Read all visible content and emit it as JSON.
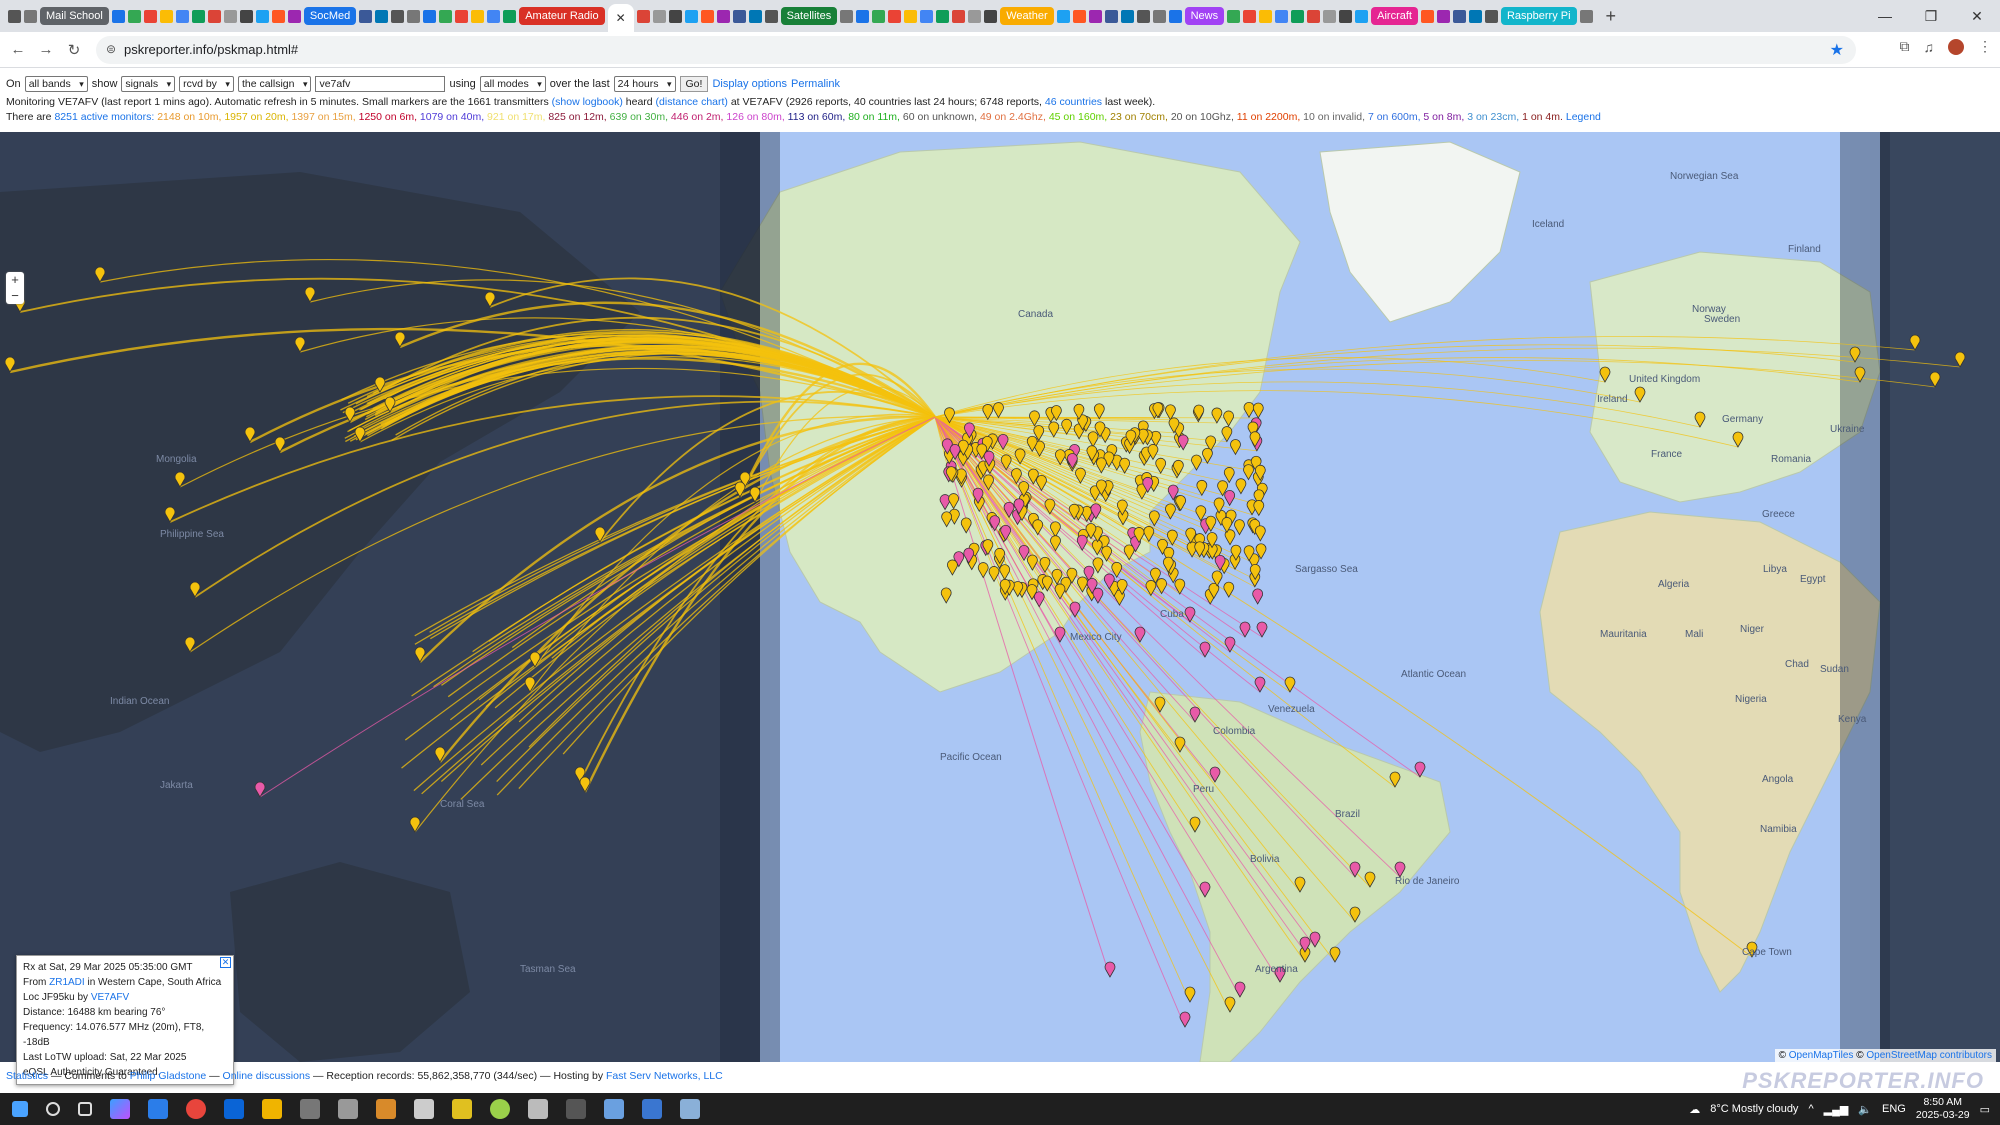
{
  "browser": {
    "tab_groups": [
      "Mail School",
      "SocMed",
      "Amateur Radio",
      "Satellites",
      "Weather",
      "News",
      "Aircraft",
      "Raspberry Pi"
    ],
    "tab_group_colors": [
      "#5f6368",
      "#1a73e8",
      "#d93025",
      "#188038",
      "#f9ab00",
      "#a142f4",
      "#e52592",
      "#12b5cb"
    ],
    "new_tab": "+",
    "url": "pskreporter.info/pskmap.html#",
    "window_controls": [
      "—",
      "❐",
      "✕"
    ]
  },
  "controls": {
    "on_label": "On",
    "band": "all bands",
    "show_label": "show",
    "show_value": "signals",
    "rcvd": "rcvd by",
    "callsign_scope": "the callsign",
    "callsign": "ve7afv",
    "using_label": "using",
    "mode": "all modes",
    "over_label": "over the last",
    "period": "24 hours",
    "go": "Go!",
    "display_options": "Display options",
    "permalink": "Permalink"
  },
  "status": {
    "monitoring_pre": "Monitoring VE7AFV (last report 1 mins ago). Automatic refresh in 5 minutes. Small markers are the 1661 transmitters",
    "show_logbook": "(show logbook)",
    "heard": "heard",
    "distance_chart": "(distance chart)",
    "monitoring_post": "at VE7AFV (2926 reports, 40 countries last 24 hours; 6748 reports,",
    "countries_link": "46 countries",
    "last_week": "last week).",
    "there_are": "There are",
    "active_monitors": "8251 active monitors:",
    "bands": [
      {
        "text": "2148 on 10m,",
        "color": "#e89a2e"
      },
      {
        "text": "1957 on 20m,",
        "color": "#d9b400"
      },
      {
        "text": "1397 on 15m,",
        "color": "#e8a040"
      },
      {
        "text": "1250 on 6m,",
        "color": "#c0002a"
      },
      {
        "text": "1079 on 40m,",
        "color": "#4f3bd8"
      },
      {
        "text": "921 on 17m,",
        "color": "#f0e070"
      },
      {
        "text": "825 on 12m,",
        "color": "#8b1a3a"
      },
      {
        "text": "639 on 30m,",
        "color": "#43b043"
      },
      {
        "text": "446 on 2m,",
        "color": "#c02070"
      },
      {
        "text": "126 on 80m,",
        "color": "#cc44cc"
      },
      {
        "text": "113 on 60m,",
        "color": "#222288"
      },
      {
        "text": "80 on 11m,",
        "color": "#20b020"
      },
      {
        "text": "60 on unknown,",
        "color": "#555555"
      },
      {
        "text": "49 on 2.4Ghz,",
        "color": "#e07040"
      },
      {
        "text": "45 on 160m,",
        "color": "#60d000"
      },
      {
        "text": "23 on 70cm,",
        "color": "#a08000"
      },
      {
        "text": "20 on 10Ghz,",
        "color": "#555555"
      },
      {
        "text": "11 on 2200m,",
        "color": "#e04000"
      },
      {
        "text": "10 on invalid,",
        "color": "#666666"
      },
      {
        "text": "7 on 600m,",
        "color": "#3070e0"
      },
      {
        "text": "5 on 8m,",
        "color": "#8020a0"
      },
      {
        "text": "3 on 23cm,",
        "color": "#4090d0"
      },
      {
        "text": "1 on 4m.",
        "color": "#8a2020"
      }
    ],
    "legend": "Legend"
  },
  "map": {
    "zoom_in": "+",
    "zoom_out": "−",
    "place_labels": [
      "Canada",
      "Norwegian Sea",
      "Iceland",
      "Finland",
      "Sweden",
      "Norway",
      "United Kingdom",
      "Ireland",
      "France",
      "Germany",
      "Algeria",
      "Libya",
      "Egypt",
      "Mali",
      "Niger",
      "Chad",
      "Sudan",
      "Nigeria",
      "Mauritania",
      "Atlantic Ocean",
      "Sargasso Sea",
      "Pacific Ocean",
      "Venezuela",
      "Colombia",
      "Peru",
      "Brazil",
      "Bolivia",
      "Argentina",
      "Mexico City",
      "Cuba",
      "Mongolia",
      "Philippine Sea",
      "Indian Ocean",
      "Jakarta",
      "Coral Sea",
      "Tasman Sea",
      "Cape Town",
      "Angola",
      "Namibia",
      "Kenya",
      "Ukraine",
      "Romania",
      "Greece",
      "Rio de Janeiro"
    ],
    "attribution_prefix": "©",
    "attribution_1": "OpenMapTiles",
    "attribution_2": "OpenStreetMap contributors"
  },
  "popup": {
    "line1": "Rx at Sat, 29 Mar 2025 05:35:00 GMT",
    "from_label": "From",
    "from_call": "ZR1ADI",
    "from_location": "in Western Cape, South Africa",
    "loc_pre": "Loc JF95ku by",
    "loc_call": "VE7AFV",
    "distance": "Distance: 16488 km bearing 76°",
    "frequency": "Frequency: 14.076.577 MHz (20m), FT8, -18dB",
    "lotw": "Last LoTW upload: Sat, 22 Mar 2025",
    "eqsl": "eQSL Authenticity Guaranteed.",
    "close": "✕"
  },
  "footer": {
    "statistics": "Statistics",
    "comments": "— Comments to",
    "author": "Philip Gladstone",
    "dash": "—",
    "discussions": "Online discussions",
    "records": "— Reception records: 55,862,358,770 (344/sec) — Hosting by",
    "host": "Fast Serv Networks, LLC",
    "brand": "PSKREPORTER.INFO"
  },
  "taskbar": {
    "weather": "8°C  Mostly cloudy",
    "lang": "ENG",
    "time": "8:50 AM",
    "date": "2025-03-29"
  }
}
